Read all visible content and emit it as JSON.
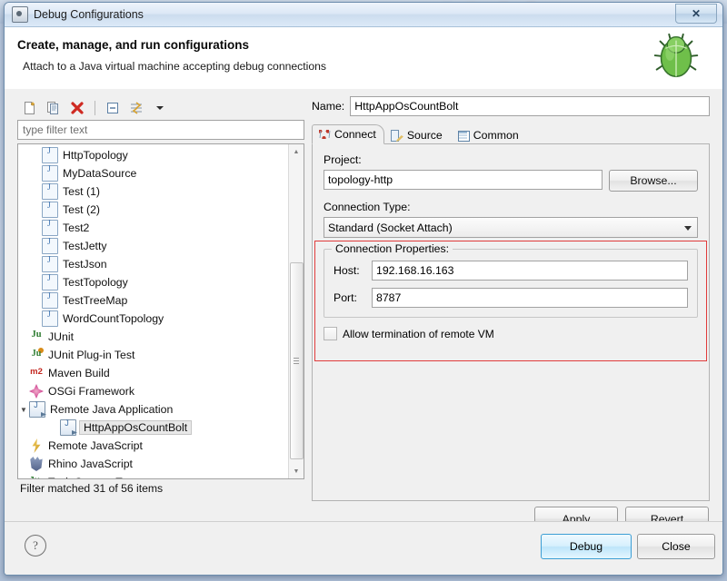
{
  "window": {
    "title": "Debug Configurations",
    "title_icon": "debug-config-icon",
    "close_glyph": "✕"
  },
  "banner": {
    "heading": "Create, manage, and run configurations",
    "subtitle": "Attach to a Java virtual machine accepting debug connections",
    "decor_icon": "green-bug-icon"
  },
  "left_panel": {
    "toolbar": [
      {
        "name": "new-launch-configuration-icon",
        "tooltip": "New launch configuration"
      },
      {
        "name": "duplicate-icon",
        "tooltip": "Duplicate"
      },
      {
        "name": "delete-icon",
        "tooltip": "Delete"
      },
      {
        "name": "collapse-all-icon",
        "tooltip": "Collapse All"
      },
      {
        "name": "filter-icon",
        "tooltip": "Filter launch configurations"
      },
      {
        "name": "chevron-down-icon",
        "tooltip": "Menu"
      }
    ],
    "filter_placeholder": "type filter text",
    "filter_value": "",
    "tree": [
      {
        "label": "HttpTopology",
        "icon": "java-config-icon",
        "indent": 1,
        "selected": false,
        "twisty": ""
      },
      {
        "label": "MyDataSource",
        "icon": "java-config-icon",
        "indent": 1,
        "selected": false,
        "twisty": ""
      },
      {
        "label": "Test (1)",
        "icon": "java-config-icon",
        "indent": 1,
        "selected": false,
        "twisty": ""
      },
      {
        "label": "Test (2)",
        "icon": "java-config-icon",
        "indent": 1,
        "selected": false,
        "twisty": ""
      },
      {
        "label": "Test2",
        "icon": "java-config-icon",
        "indent": 1,
        "selected": false,
        "twisty": ""
      },
      {
        "label": "TestJetty",
        "icon": "java-config-icon",
        "indent": 1,
        "selected": false,
        "twisty": ""
      },
      {
        "label": "TestJson",
        "icon": "java-config-icon",
        "indent": 1,
        "selected": false,
        "twisty": ""
      },
      {
        "label": "TestTopology",
        "icon": "java-config-icon",
        "indent": 1,
        "selected": false,
        "twisty": ""
      },
      {
        "label": "TestTreeMap",
        "icon": "java-config-icon",
        "indent": 1,
        "selected": false,
        "twisty": ""
      },
      {
        "label": "WordCountTopology",
        "icon": "java-config-icon",
        "indent": 1,
        "selected": false,
        "twisty": ""
      },
      {
        "label": "JUnit",
        "icon": "junit-icon",
        "indent": 0,
        "selected": false,
        "twisty": ""
      },
      {
        "label": "JUnit Plug-in Test",
        "icon": "junit-plugin-icon",
        "indent": 0,
        "selected": false,
        "twisty": ""
      },
      {
        "label": "Maven Build",
        "icon": "maven-icon",
        "indent": 0,
        "selected": false,
        "twisty": ""
      },
      {
        "label": "OSGi Framework",
        "icon": "osgi-icon",
        "indent": 0,
        "selected": false,
        "twisty": ""
      },
      {
        "label": "Remote Java Application",
        "icon": "remote-java-icon",
        "indent": 0,
        "selected": false,
        "twisty": "▼"
      },
      {
        "label": "HttpAppOsCountBolt",
        "icon": "remote-java-icon",
        "indent": 2,
        "selected": true,
        "twisty": ""
      },
      {
        "label": "Remote JavaScript",
        "icon": "remote-javascript-icon",
        "indent": 0,
        "selected": false,
        "twisty": ""
      },
      {
        "label": "Rhino JavaScript",
        "icon": "rhino-icon",
        "indent": 0,
        "selected": false,
        "twisty": ""
      },
      {
        "label": "Task Context Test",
        "icon": "task-context-test-icon",
        "indent": 0,
        "selected": false,
        "twisty": ""
      }
    ],
    "scroll": {
      "up_glyph": "▲",
      "down_glyph": "▼"
    },
    "status": "Filter matched 31 of 56 items"
  },
  "right_panel": {
    "name_label": "Name:",
    "name_value": "HttpAppOsCountBolt",
    "tabs": [
      {
        "label": "Connect",
        "icon": "connect-icon",
        "active": true
      },
      {
        "label": "Source",
        "icon": "source-icon",
        "active": false
      },
      {
        "label": "Common",
        "icon": "common-icon",
        "active": false
      }
    ],
    "project_label": "Project:",
    "project_value": "topology-http",
    "browse_label": "Browse...",
    "connection_type_label": "Connection Type:",
    "connection_type_value": "Standard (Socket Attach)",
    "connection_properties_label": "Connection Properties:",
    "host_label": "Host:",
    "host_value": "192.168.16.163",
    "port_label": "Port:",
    "port_value": "8787",
    "allow_termination_label": "Allow termination of remote VM",
    "allow_termination_checked": false,
    "apply_label": "Apply",
    "revert_label": "Revert",
    "highlight_color": "#e03b3b"
  },
  "footer": {
    "help_glyph": "?",
    "debug_label": "Debug",
    "close_label": "Close"
  }
}
